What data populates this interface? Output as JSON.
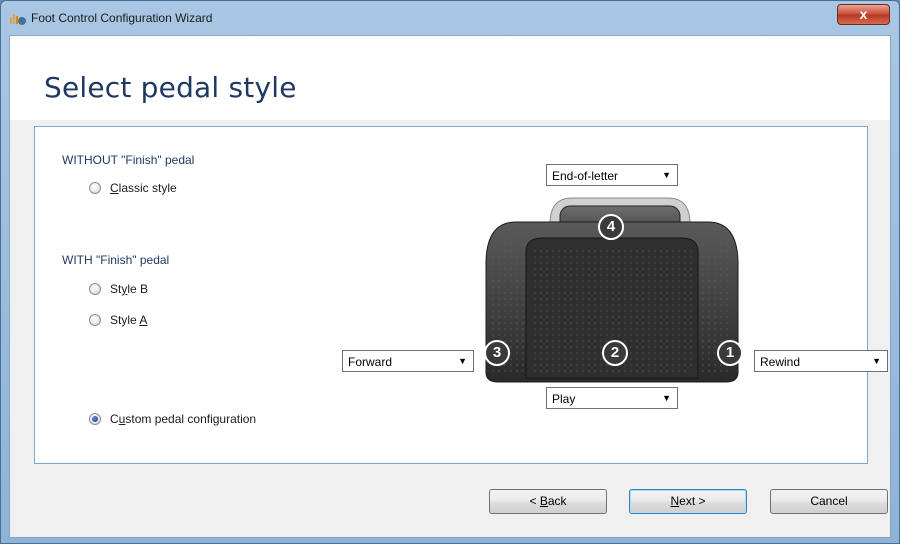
{
  "window": {
    "title": "Foot Control Configuration Wizard",
    "close_glyph": "x"
  },
  "page": {
    "title": "Select pedal style"
  },
  "options": {
    "group_without": "WITHOUT \"Finish\" pedal",
    "group_with": "WITH \"Finish\" pedal",
    "classic": {
      "mnemonic": "C",
      "rest": "lassic style",
      "checked": false
    },
    "style_b": {
      "before": "St",
      "mnemonic": "y",
      "after": "le B",
      "checked": false
    },
    "style_a": {
      "before": "Style ",
      "mnemonic": "A",
      "after": "",
      "checked": false
    },
    "custom": {
      "before": "C",
      "mnemonic": "u",
      "after": "stom pedal configuration",
      "checked": true
    }
  },
  "pedal": {
    "numbers": [
      "1",
      "2",
      "3",
      "4"
    ],
    "dropdowns": {
      "pedal4": "End-of-letter",
      "pedal3": "Forward",
      "pedal2": "Play",
      "pedal1": "Rewind"
    },
    "colors": {
      "body": "#3b3b3b",
      "body_dark": "#232323",
      "highlight": "#6a6a6a"
    }
  },
  "buttons": {
    "back": {
      "before": "< ",
      "mnemonic": "B",
      "after": "ack"
    },
    "next": {
      "before": "",
      "mnemonic": "N",
      "after": "ext >"
    },
    "cancel": "Cancel"
  },
  "colors": {
    "accent": "#1e3a62",
    "panel_border": "#7fa6cc",
    "titlebar": "#a9c7e4"
  },
  "icons": {
    "app": "foot-pedal-sound-icon",
    "logo": "dragon-flame-icon",
    "close": "close-icon",
    "dropdown": "chevron-down-icon"
  }
}
